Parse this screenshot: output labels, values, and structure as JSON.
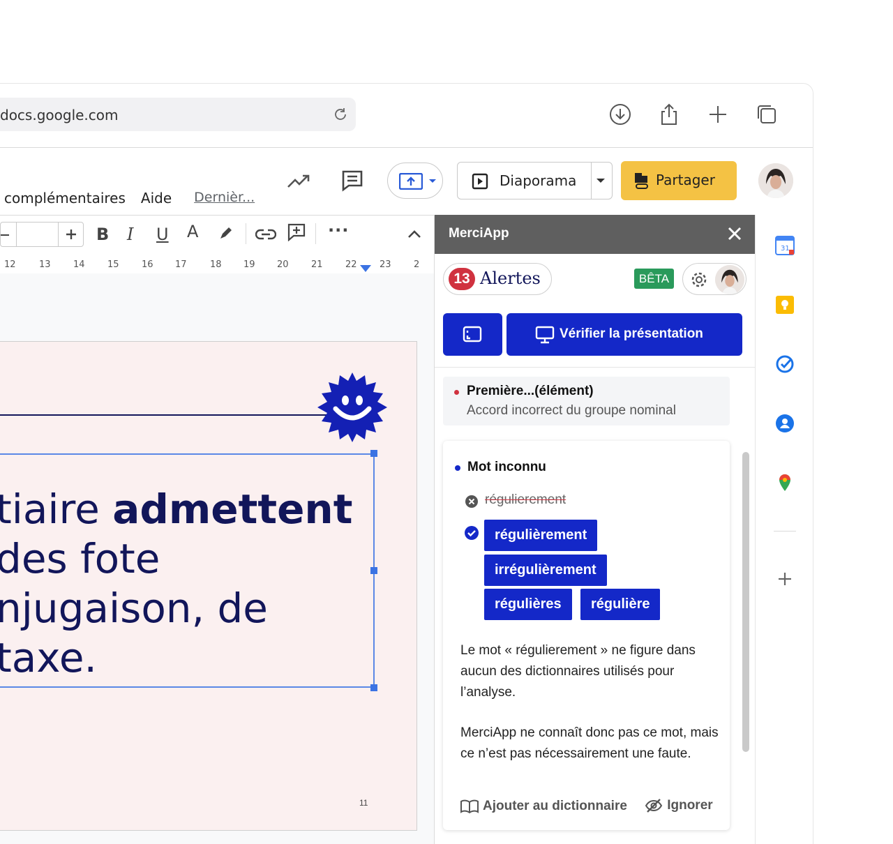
{
  "browser": {
    "url": "docs.google.com"
  },
  "menu": {
    "items": [
      "complémentaires",
      "Aide"
    ],
    "last_edit": "Dernièr..."
  },
  "header": {
    "slideshow_label": "Diaporama",
    "share_label": "Partager"
  },
  "ruler": {
    "ticks": [
      "12",
      "13",
      "14",
      "15",
      "16",
      "17",
      "18",
      "19",
      "20",
      "21",
      "22",
      "23",
      "2"
    ]
  },
  "slide": {
    "line1_normal": "tiaire ",
    "line1_bold": "admettent",
    "line2": "des fote",
    "line3": "njugaison, de",
    "line4": "taxe.",
    "page_number": "11"
  },
  "panel": {
    "title": "MerciApp",
    "alerts_count": "13",
    "alerts_label": "Alertes",
    "beta_label": "BÊTA",
    "verify_label": "Vérifier la présentation",
    "alert1": {
      "title": "Première...(élément)",
      "subtitle": "Accord incorrect du groupe nominal"
    },
    "alert2": {
      "title": "Mot inconnu",
      "wrong_word": "régulierement",
      "suggestions": [
        "régulièrement",
        "irrégulièrement",
        "régulières",
        "régulière"
      ],
      "explanation_1": "Le mot « régulierement » ne figure dans aucun des dictionnaires utilisés pour l’analyse.",
      "explanation_2": "MerciApp ne connaît donc pas ce mot, mais ce n’est pas nécessairement une faute.",
      "add_dictionary": "Ajouter au dictionnaire",
      "ignore": "Ignorer"
    }
  },
  "colors": {
    "merciapp_blue": "#1428c8",
    "alert_red": "#d0323f",
    "beta_green": "#2a9a5b",
    "share_yellow": "#f4c244",
    "slide_bg": "#fbf0f0"
  }
}
